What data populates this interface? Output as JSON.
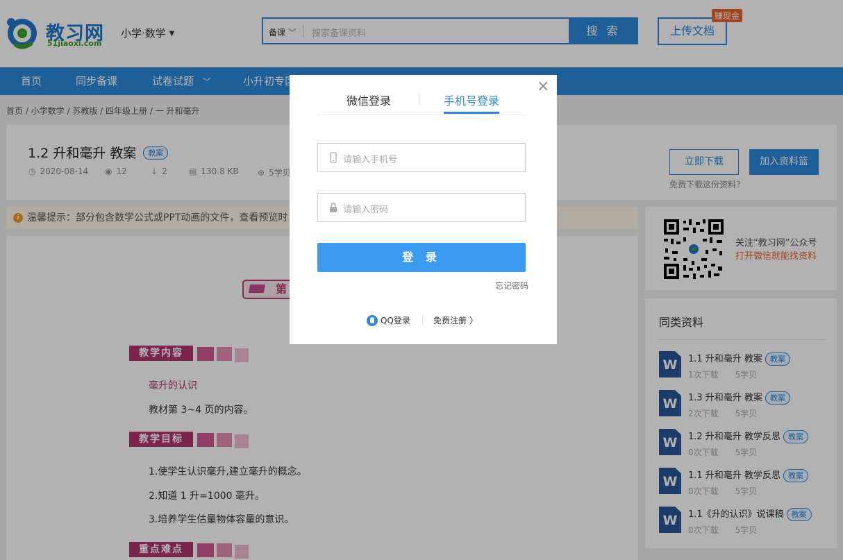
{
  "header": {
    "logo_text": "教习网",
    "logo_sub": "51jiaoxi.com",
    "subject": "小学·数学",
    "search": {
      "category": "备课",
      "placeholder": "搜索备课资料",
      "button": "搜 索"
    },
    "upload": "上传文档",
    "earn_badge": "赚现金"
  },
  "nav": {
    "items": [
      "首页",
      "同步备课",
      "试卷试题",
      "小升初专区"
    ]
  },
  "breadcrumb": "首页 / 小学数学 / 苏教版 / 四年级上册 / 一 升和毫升",
  "doc": {
    "title": "1.2 升和毫升 教案",
    "tag": "教案",
    "date": "2020-08-14",
    "views": "12",
    "downloads": "2",
    "size": "130.8 KB",
    "price": "5学贝",
    "download_button": "立即下载",
    "basket_button": "加入资料篮",
    "free_question": "免费下载这份资料？"
  },
  "notice": {
    "icon": "i",
    "text": "温馨提示：部分包含数学公式或PPT动画的文件，查看预览时"
  },
  "preview": {
    "banner": "第",
    "sections": [
      {
        "label": "教学内容",
        "lines": [
          "毫升的认识",
          "教材第 3~4 页的内容。"
        ]
      },
      {
        "label": "教学目标",
        "lines": [
          "1.使学生认识毫升,建立毫升的概念。",
          "2.知道 1 升=1000 毫升。",
          "3.培养学生估量物体容量的意识。"
        ]
      },
      {
        "label": "重点难点",
        "lines": []
      }
    ]
  },
  "sidebar": {
    "qr_line1": "关注“教习网”公众号",
    "qr_line2": "打开微信就能找资料",
    "similar_title": "同类资料",
    "items": [
      {
        "title": "1.1 升和毫升 教案",
        "tag": "教案",
        "downloads": "1次下载",
        "price": "5学贝"
      },
      {
        "title": "1.3 升和毫升 教案",
        "tag": "教案",
        "downloads": "2次下载",
        "price": "5学贝"
      },
      {
        "title": "1.2 升和毫升 教学反思",
        "tag": "教案",
        "downloads": "0次下载",
        "price": "5学贝"
      },
      {
        "title": "1.1 升和毫升 教学反思",
        "tag": "教案",
        "downloads": "0次下载",
        "price": "5学贝"
      },
      {
        "title": "1.1《升的认识》说课稿",
        "tag": "教案",
        "downloads": "0次下载",
        "price": "5学贝"
      }
    ]
  },
  "modal": {
    "tab_wechat": "微信登录",
    "tab_phone": "手机号登录",
    "phone_placeholder": "请输入手机号",
    "password_placeholder": "请输入密码",
    "login_button": "登 录",
    "forgot": "忘记密码",
    "qq_login": "QQ登录",
    "register": "免费注册 〉"
  },
  "colors": {
    "brand": "#2b88d8",
    "accent": "#e8622c",
    "pink": "#b1356f"
  }
}
